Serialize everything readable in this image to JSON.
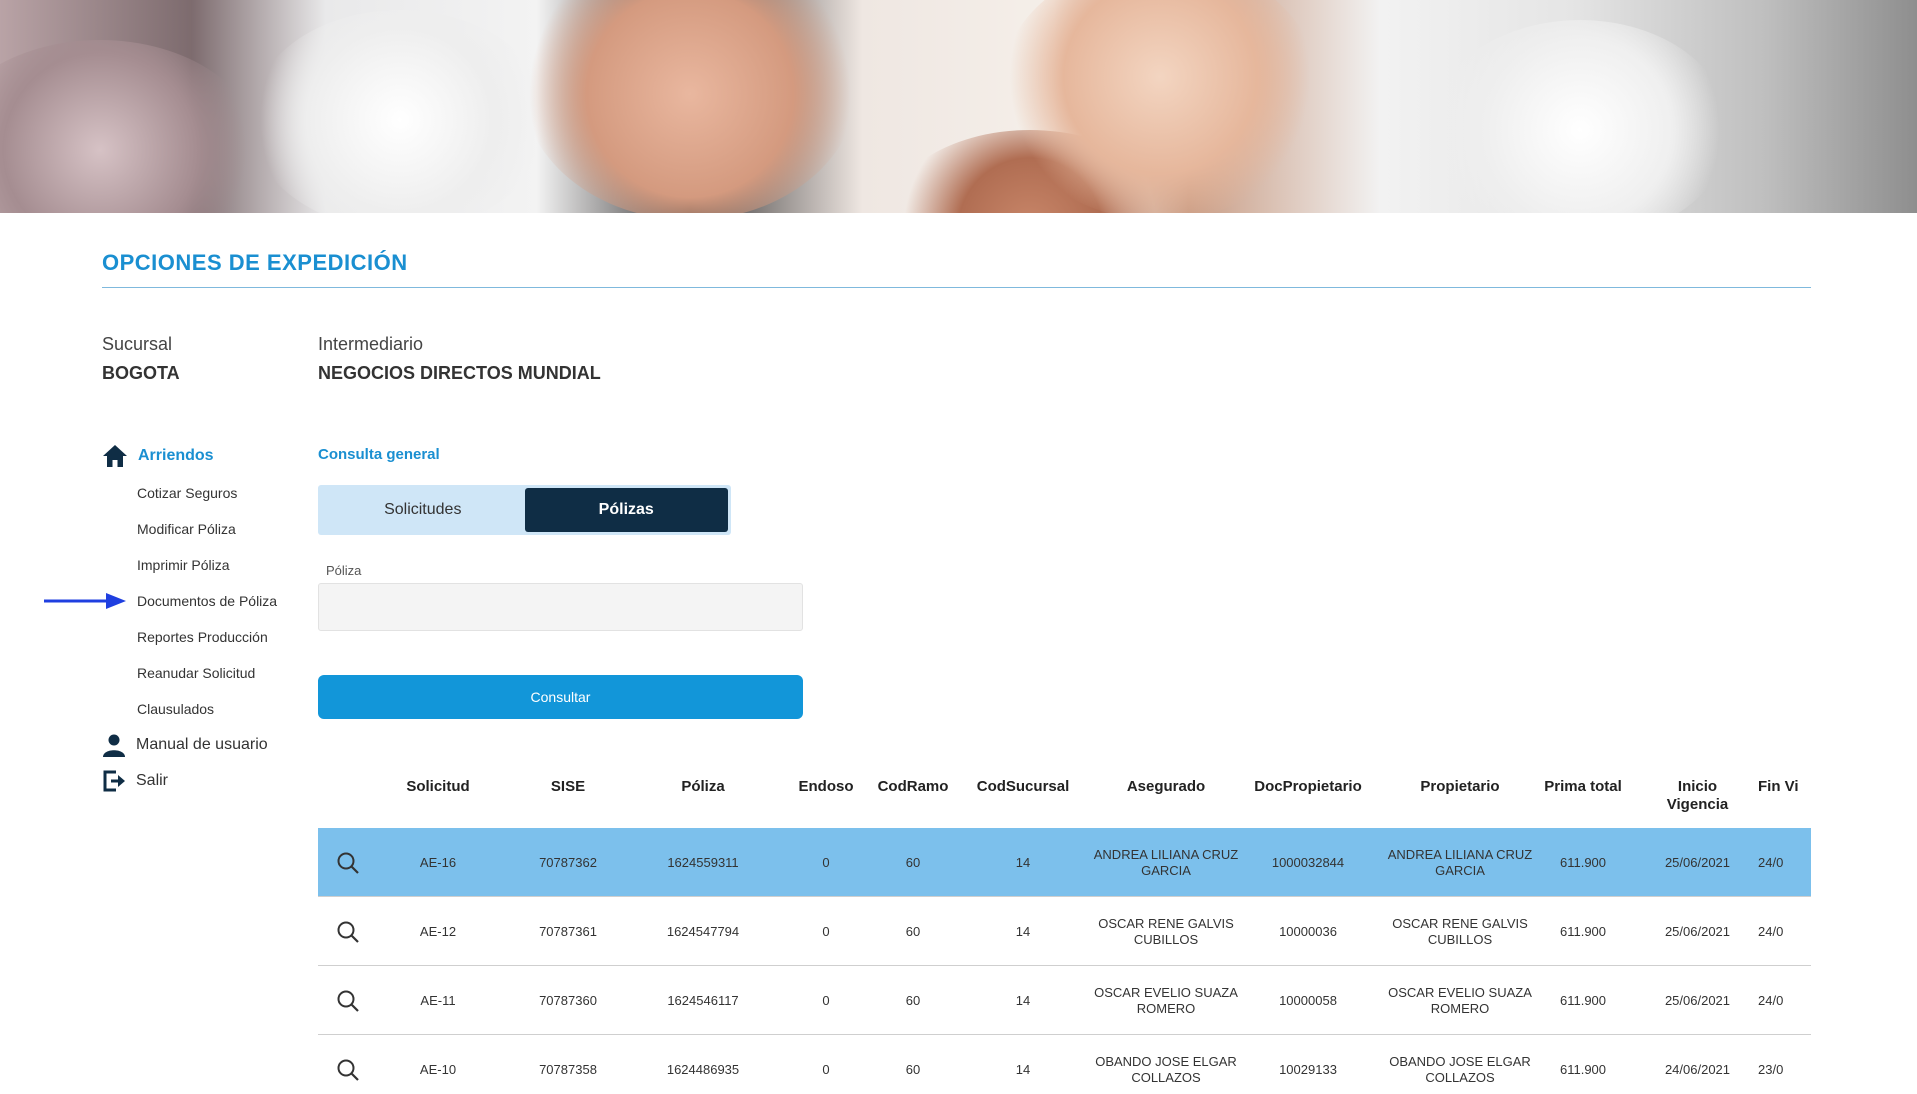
{
  "page": {
    "title": "OPCIONES DE EXPEDICIÓN"
  },
  "meta": {
    "sucursal_label": "Sucursal",
    "sucursal_value": "BOGOTA",
    "intermediario_label": "Intermediario",
    "intermediario_value": "NEGOCIOS DIRECTOS MUNDIAL"
  },
  "sidebar": {
    "section": "Arriendos",
    "items": [
      "Cotizar Seguros",
      "Modificar Póliza",
      "Imprimir Póliza",
      "Documentos de Póliza",
      "Reportes Producción",
      "Reanudar Solicitud",
      "Clausulados"
    ],
    "manual": "Manual de usuario",
    "exit": "Salir"
  },
  "main": {
    "subtitle": "Consulta general",
    "tabs": [
      "Solicitudes",
      "Pólizas"
    ],
    "active_tab": "Pólizas",
    "field_label": "Póliza",
    "field_value": "",
    "button": "Consultar"
  },
  "table": {
    "headers": [
      "Solicitud",
      "SISE",
      "Póliza",
      "Endoso",
      "CodRamo",
      "CodSucursal",
      "Asegurado",
      "DocPropietario",
      "Propietario",
      "Prima total",
      "Inicio Vigencia",
      "Fin Vi"
    ],
    "rows": [
      [
        "AE-16",
        "70787362",
        "1624559311",
        "0",
        "60",
        "14",
        "ANDREA LILIANA CRUZ GARCIA",
        "1000032844",
        "ANDREA LILIANA CRUZ GARCIA",
        "611.900",
        "25/06/2021",
        "24/0"
      ],
      [
        "AE-12",
        "70787361",
        "1624547794",
        "0",
        "60",
        "14",
        "OSCAR RENE GALVIS CUBILLOS",
        "10000036",
        "OSCAR RENE GALVIS CUBILLOS",
        "611.900",
        "25/06/2021",
        "24/0"
      ],
      [
        "AE-11",
        "70787360",
        "1624546117",
        "0",
        "60",
        "14",
        "OSCAR EVELIO SUAZA ROMERO",
        "10000058",
        "OSCAR EVELIO SUAZA ROMERO",
        "611.900",
        "25/06/2021",
        "24/0"
      ],
      [
        "AE-10",
        "70787358",
        "1624486935",
        "0",
        "60",
        "14",
        "OBANDO JOSE ELGAR COLLAZOS",
        "10029133",
        "OBANDO JOSE ELGAR COLLAZOS",
        "611.900",
        "24/06/2021",
        "23/0"
      ]
    ],
    "selected_row": 0
  },
  "colors": {
    "accent": "#1a8fd1",
    "dark": "#0f2d45",
    "selected_row": "#7cc0ec",
    "button": "#1296d9"
  }
}
